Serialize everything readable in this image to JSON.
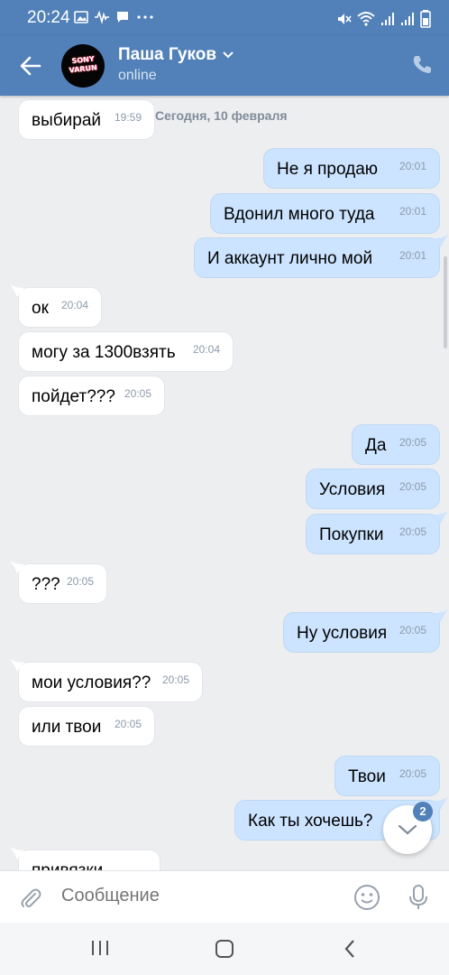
{
  "status_bar": {
    "time": "20:24"
  },
  "header": {
    "contact_name": "Паша Гуков",
    "presence": "online",
    "avatar_text_line1": "SONY",
    "avatar_text_line2": "VARUN"
  },
  "date_separator": "Сегодня, 10 февраля",
  "messages": [
    {
      "side": "in",
      "text": "выбирай",
      "time": "19:59"
    },
    {
      "side": "out",
      "text": "Не я продаю",
      "time": "20:01"
    },
    {
      "side": "out",
      "text": "Вдонил много туда",
      "time": "20:01"
    },
    {
      "side": "out",
      "text": "И аккаунт лично мой",
      "time": "20:01"
    },
    {
      "side": "in",
      "text": "ок",
      "time": "20:04"
    },
    {
      "side": "in",
      "text": "могу за 1300взять",
      "time": "20:04"
    },
    {
      "side": "in",
      "text": "пойдет???",
      "time": "20:05"
    },
    {
      "side": "out",
      "text": "Да",
      "time": "20:05"
    },
    {
      "side": "out",
      "text": "Условия",
      "time": "20:05"
    },
    {
      "side": "out",
      "text": "Покупки",
      "time": "20:05"
    },
    {
      "side": "in",
      "text": "???",
      "time": "20:05"
    },
    {
      "side": "out",
      "text": "Ну условия",
      "time": "20:05"
    },
    {
      "side": "in",
      "text": "мои условия??",
      "time": "20:05"
    },
    {
      "side": "in",
      "text": "или твои",
      "time": "20:05"
    },
    {
      "side": "out",
      "text": "Твои",
      "time": "20:05"
    },
    {
      "side": "out",
      "text": "Как ты хочешь?",
      "time": ""
    },
    {
      "side": "in",
      "text": "привязки",
      "time": ""
    }
  ],
  "scroll_down_badge": "2",
  "composer": {
    "placeholder": "Сообщение"
  },
  "colors": {
    "accent": "#5181b8",
    "outgoing_bubble": "#cce4ff",
    "incoming_bubble": "#ffffff",
    "background": "#edeef0"
  }
}
